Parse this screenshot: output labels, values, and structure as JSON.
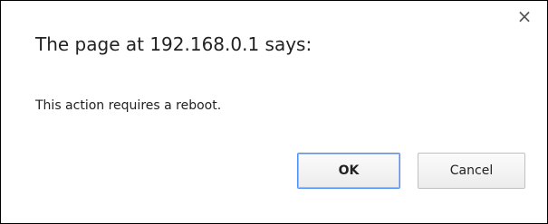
{
  "dialog": {
    "title": "The page at 192.168.0.1 says:",
    "message": "This action requires a reboot.",
    "close_glyph": "×",
    "ok_label": "OK",
    "cancel_label": "Cancel"
  },
  "icons": {
    "close": "close-icon"
  },
  "colors": {
    "border": "#000000",
    "default_button_focus": "#4d90fe"
  }
}
